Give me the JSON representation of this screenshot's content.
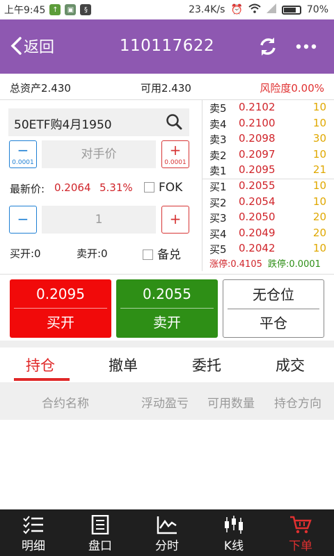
{
  "status_bar": {
    "time": "上午9:45",
    "speed": "23.4K/s",
    "battery": "70%"
  },
  "header": {
    "back_label": "返回",
    "title": "110117622"
  },
  "account": {
    "total_assets": "总资产2.430",
    "available": "可用2.430",
    "risk": "风险度0.00%"
  },
  "form": {
    "contract": "50ETF购4月1950",
    "price_placeholder": "对手价",
    "tick_step": "0.0001",
    "latest_label": "最新价:",
    "latest_price": "0.2064",
    "latest_change": "5.31%",
    "fok_label": "FOK",
    "quantity": "1",
    "buy_open_count": "买开:0",
    "sell_open_count": "卖开:0",
    "covered_label": "备兑"
  },
  "order_book": {
    "asks": [
      {
        "label": "卖5",
        "price": "0.2102",
        "volume": "10"
      },
      {
        "label": "卖4",
        "price": "0.2100",
        "volume": "10"
      },
      {
        "label": "卖3",
        "price": "0.2098",
        "volume": "30"
      },
      {
        "label": "卖2",
        "price": "0.2097",
        "volume": "10"
      },
      {
        "label": "卖1",
        "price": "0.2095",
        "volume": "21"
      }
    ],
    "bids": [
      {
        "label": "买1",
        "price": "0.2055",
        "volume": "10"
      },
      {
        "label": "买2",
        "price": "0.2054",
        "volume": "10"
      },
      {
        "label": "买3",
        "price": "0.2050",
        "volume": "20"
      },
      {
        "label": "买4",
        "price": "0.2049",
        "volume": "20"
      },
      {
        "label": "买5",
        "price": "0.2042",
        "volume": "10"
      }
    ],
    "limit_up": "涨停:0.4105",
    "limit_down": "跌停:0.0001"
  },
  "actions": {
    "buy_open_price": "0.2095",
    "buy_open_label": "买开",
    "sell_open_price": "0.2055",
    "sell_open_label": "卖开",
    "position_status": "无仓位",
    "close_label": "平仓"
  },
  "tabs": [
    "持仓",
    "撤单",
    "委托",
    "成交"
  ],
  "columns": [
    "合约名称",
    "浮动盈亏",
    "可用数量",
    "持仓方向"
  ],
  "bottom_nav": [
    "明细",
    "盘口",
    "分时",
    "K线",
    "下单"
  ],
  "colors": {
    "header": "#8e58b1",
    "buy": "#f10a0a",
    "sell": "#2e8f16",
    "accent_red": "#e02828",
    "blue": "#1e7fd4"
  }
}
